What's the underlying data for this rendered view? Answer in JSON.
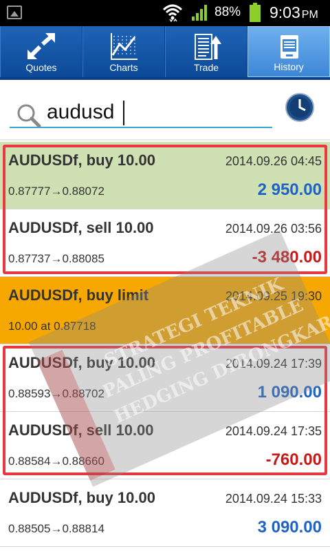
{
  "status_bar": {
    "battery_percent": "88%",
    "time": "9:03",
    "ampm": "PM"
  },
  "tabs": [
    {
      "label": "Quotes",
      "icon": "quotes-arrows-icon"
    },
    {
      "label": "Charts",
      "icon": "chart-line-icon"
    },
    {
      "label": "Trade",
      "icon": "trade-doc-icon"
    },
    {
      "label": "History",
      "icon": "history-icon",
      "active": true
    }
  ],
  "search": {
    "value": "audusd"
  },
  "rows": [
    {
      "title": "AUDUSDf, buy 10.00",
      "date": "2014.09.26 04:45",
      "prices": "0.87777→0.88072",
      "profit": "2 950.00",
      "profit_sign": "pos",
      "bg": "green"
    },
    {
      "title": "AUDUSDf, sell 10.00",
      "date": "2014.09.26 03:56",
      "prices": "0.87737→0.88085",
      "profit": "-3 480.00",
      "profit_sign": "neg",
      "bg": "white"
    },
    {
      "title": "AUDUSDf, buy limit",
      "date": "2014.09.25 19:30",
      "prices": "10.00 at 0.87718",
      "profit": "",
      "profit_sign": "",
      "bg": "orange"
    },
    {
      "title": "AUDUSDf, buy 10.00",
      "date": "2014.09.24 17:39",
      "prices": "0.88593→0.88702",
      "profit": "1 090.00",
      "profit_sign": "pos",
      "bg": "white"
    },
    {
      "title": "AUDUSDf, sell 10.00",
      "date": "2014.09.24 17:35",
      "prices": "0.88584→0.88660",
      "profit": "-760.00",
      "profit_sign": "neg",
      "bg": "white"
    },
    {
      "title": "AUDUSDf, buy 10.00",
      "date": "2014.09.24 15:33",
      "prices": "0.88505→0.88814",
      "profit": "3 090.00",
      "profit_sign": "pos",
      "bg": "white"
    }
  ],
  "colors": {
    "tab_bar": "#0f4d99",
    "tab_active": "#5a9ee6",
    "profit_positive": "#1d62c4",
    "profit_negative": "#c81818",
    "highlight_box": "#e8383f",
    "row_green": "#cfe0b3",
    "row_orange": "#f6a800"
  },
  "watermark": {
    "line1": "STRATEGI TEKNIK",
    "line2": "PALING PROFITABLE",
    "line3": "HEDGING DIBONGKAR!"
  }
}
